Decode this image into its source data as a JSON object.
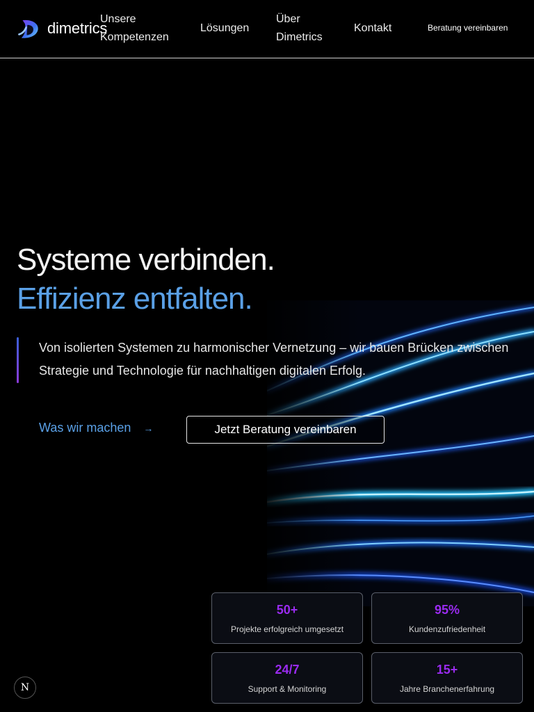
{
  "header": {
    "logo_text": "dimetrics",
    "nav": [
      {
        "label": "Unsere Kompetenzen"
      },
      {
        "label": "Lösungen"
      },
      {
        "label": "Über Dimetrics"
      },
      {
        "label": "Kontakt"
      }
    ],
    "cta_label": "Beratung vereinbaren"
  },
  "hero": {
    "title_line1": "Systeme verbinden.",
    "title_line2": "Effizienz entfalten.",
    "subtitle": "Von isolierten Systemen zu harmonischer Vernetzung – wir bauen Brücken zwischen Strategie und Technologie für nachhaltigen digitalen Erfolg.",
    "link_label": "Was wir machen",
    "button_label": "Jetzt Beratung vereinbaren"
  },
  "stats": [
    {
      "value": "50+",
      "label": "Projekte erfolgreich umgesetzt"
    },
    {
      "value": "95%",
      "label": "Kundenzufriedenheit"
    },
    {
      "value": "24/7",
      "label": "Support & Monitoring"
    },
    {
      "value": "15+",
      "label": "Jahre Branchenerfahrung"
    }
  ],
  "colors": {
    "accent_blue": "#5aa0e6",
    "stat_purple": "#9a2bf0",
    "background": "#000000"
  },
  "icons": {
    "logo": "dimetrics-logo-icon",
    "arrow": "arrow-right-icon",
    "badge": "next-n-icon"
  },
  "badge": {
    "letter": "N"
  }
}
